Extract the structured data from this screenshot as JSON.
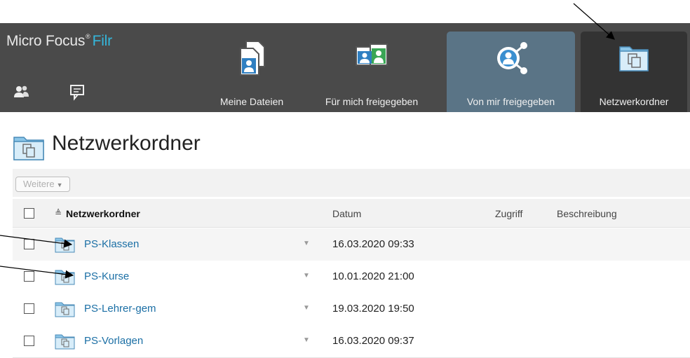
{
  "header": {
    "brand": {
      "name": "Micro Focus",
      "reg_mark": "®",
      "product": "Filr"
    },
    "utility_icons": [
      "people-icon",
      "comment-icon"
    ],
    "nav_tabs": [
      {
        "label": "Meine Dateien",
        "icon": "my-files-icon",
        "state": "normal"
      },
      {
        "label": "Für mich freigegeben",
        "icon": "shared-with-me-icon",
        "state": "normal"
      },
      {
        "label": "Von mir freigegeben",
        "icon": "shared-by-me-icon",
        "state": "hover"
      },
      {
        "label": "Netzwerkordner",
        "icon": "net-folders-icon",
        "state": "selected"
      }
    ]
  },
  "page": {
    "title": "Netzwerkordner"
  },
  "toolbar": {
    "more_label": "Weitere"
  },
  "table": {
    "columns": {
      "name": "Netzwerkordner",
      "date": "Datum",
      "access": "Zugriff",
      "description": "Beschreibung"
    },
    "sort_indicator": "≜",
    "rows": [
      {
        "name": "PS-Klassen",
        "date": "16.03.2020 09:33"
      },
      {
        "name": "PS-Kurse",
        "date": "10.01.2020 21:00"
      },
      {
        "name": "PS-Lehrer-gem",
        "date": "19.03.2020 19:50"
      },
      {
        "name": "PS-Vorlagen",
        "date": "16.03.2020 09:37"
      }
    ]
  },
  "colors": {
    "header_bg": "#4a4a4a",
    "hover_tab_bg": "#5a7486",
    "selected_tab_bg": "#333333",
    "brand_product": "#34b7dc",
    "link": "#1b6fa5"
  }
}
